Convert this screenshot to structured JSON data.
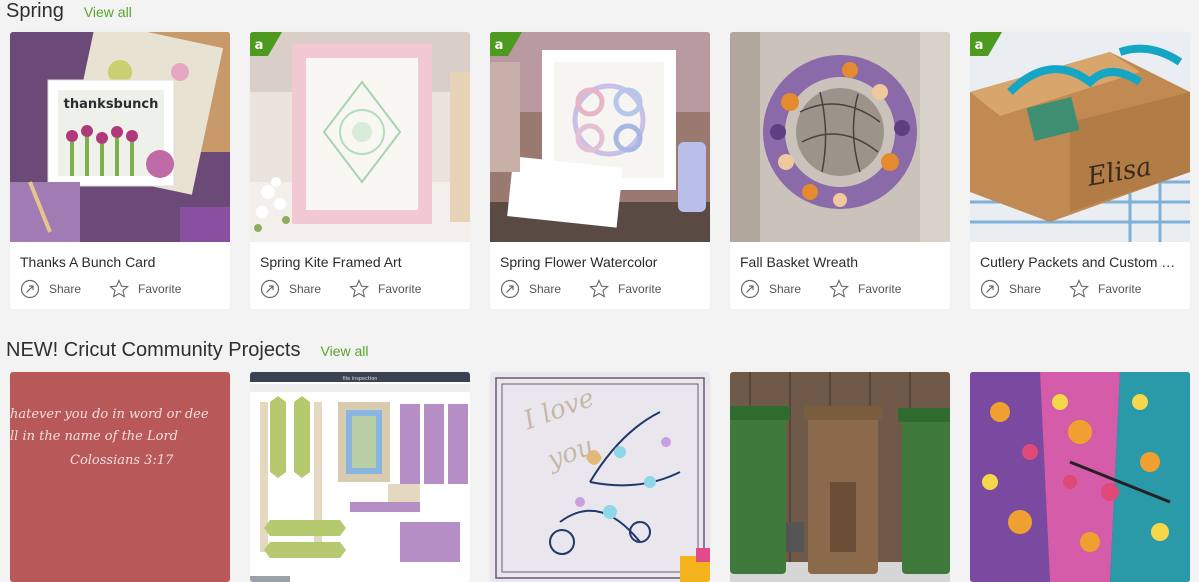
{
  "sections": [
    {
      "title": "Spring",
      "view_all": "View all",
      "cards": [
        {
          "title": "Thanks A Bunch Card",
          "share": "Share",
          "favorite": "Favorite",
          "access_badge": false
        },
        {
          "title": "Spring Kite Framed Art",
          "share": "Share",
          "favorite": "Favorite",
          "access_badge": true
        },
        {
          "title": "Spring Flower Watercolor",
          "share": "Share",
          "favorite": "Favorite",
          "access_badge": true
        },
        {
          "title": "Fall Basket Wreath",
          "share": "Share",
          "favorite": "Favorite",
          "access_badge": false
        },
        {
          "title": "Cutlery Packets and Custom …",
          "share": "Share",
          "favorite": "Favorite",
          "access_badge": true
        }
      ]
    },
    {
      "title": "NEW! Cricut Community Projects",
      "view_all": "View all",
      "cards": [
        {
          "image_text": [
            "hatever you do in word or dee",
            "ll in the name of the Lord",
            "Colossians 3:17"
          ]
        },
        {
          "image_text": [
            "file inspection"
          ]
        },
        {
          "image_text": [
            "I love",
            "you"
          ]
        },
        {
          "image_text": []
        },
        {
          "image_text": []
        }
      ]
    }
  ],
  "badge_letter": "a",
  "colors": {
    "accent": "#5aa42c",
    "badge": "#4d9a1f",
    "background": "#f3f3f3"
  }
}
